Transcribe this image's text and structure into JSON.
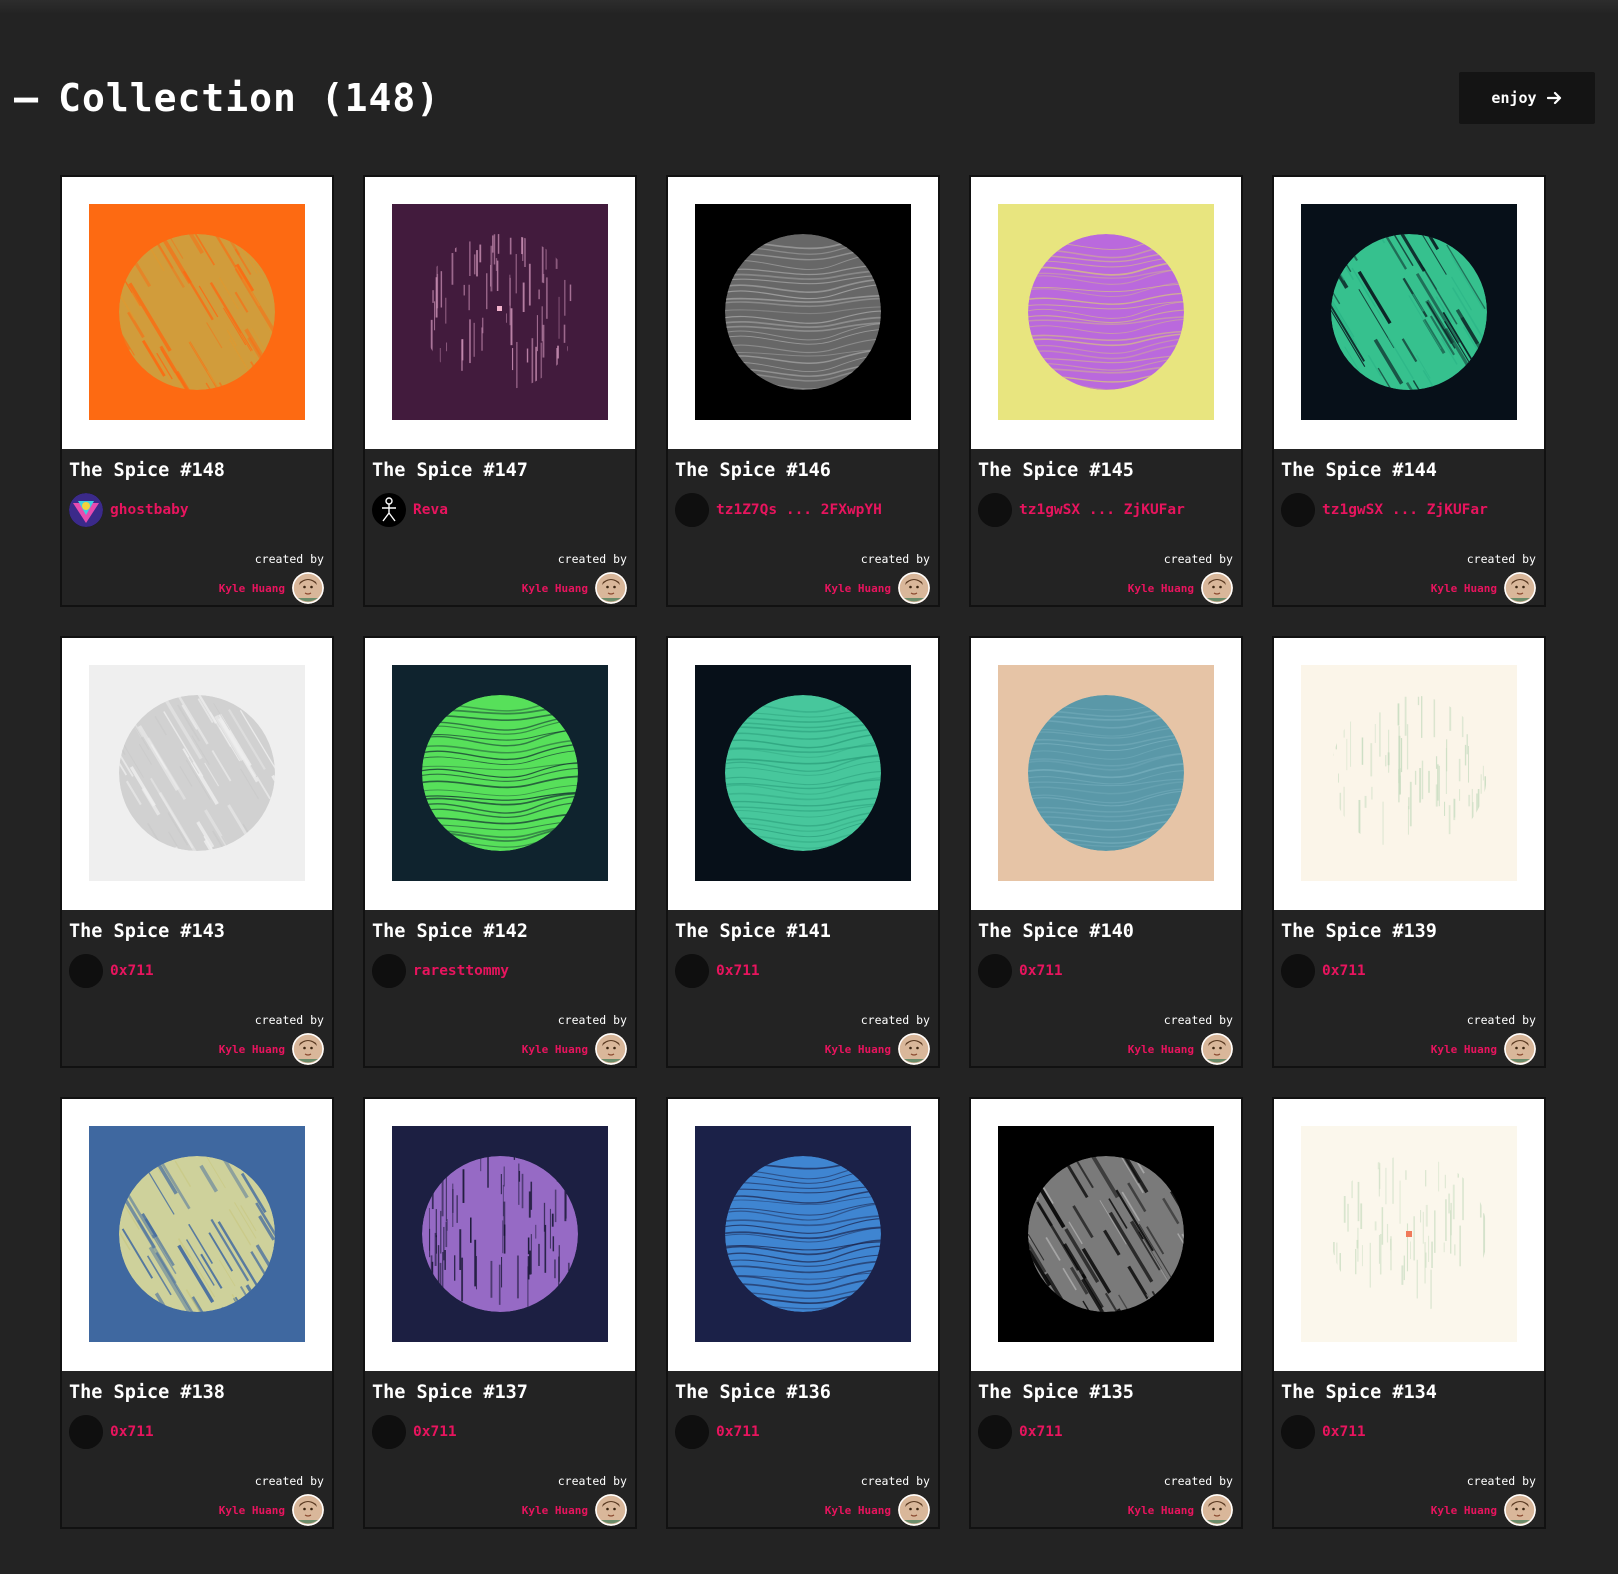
{
  "header": {
    "dash": "–",
    "title": "Collection (148)",
    "enjoy_label": "enjoy"
  },
  "cards": [
    {
      "title": "The Spice #148",
      "owner": "ghostbaby",
      "owner_avatar": "colorful-avatar",
      "created_by": "created by",
      "creator": "Kyle Huang",
      "bg": "#fd6a12",
      "fg": "#c9a443",
      "fg2": "#e09a30",
      "style": "diagonal"
    },
    {
      "title": "The Spice #147",
      "owner": "Reva",
      "owner_avatar": "stick-figure-icon",
      "created_by": "created by",
      "creator": "Kyle Huang",
      "bg": "#421b3d",
      "fg": "#c98fb4",
      "fg2": "#e6b3cc",
      "style": "sparse-vertical"
    },
    {
      "title": "The Spice #146",
      "owner": "tz1Z7Qs ... 2FXwpYH",
      "owner_avatar": "blank-avatar",
      "created_by": "created by",
      "creator": "Kyle Huang",
      "bg": "#000000",
      "fg": "#8a8a8a",
      "fg2": "#b5b5b5",
      "style": "bottom-waves"
    },
    {
      "title": "The Spice #145",
      "owner": "tz1gwSX ... ZjKUFar",
      "owner_avatar": "blank-avatar",
      "created_by": "created by",
      "creator": "Kyle Huang",
      "bg": "#e8e57f",
      "fg": "#b55be8",
      "fg2": "#d9c87a",
      "style": "waves"
    },
    {
      "title": "The Spice #144",
      "owner": "tz1gwSX ... ZjKUFar",
      "owner_avatar": "blank-avatar",
      "created_by": "created by",
      "creator": "Kyle Huang",
      "bg": "#071019",
      "fg": "#3ee0a3",
      "fg2": "#2bb385",
      "style": "diagonal"
    },
    {
      "title": "The Spice #143",
      "owner": "0x711",
      "owner_avatar": "blank-avatar",
      "created_by": "created by",
      "creator": "Kyle Huang",
      "bg": "#efefef",
      "fg": "#9a9a9a",
      "fg2": "#c8c8c8",
      "style": "diagonal-fade"
    },
    {
      "title": "The Spice #142",
      "owner": "raresttommy",
      "owner_avatar": "blank-avatar",
      "created_by": "created by",
      "creator": "Kyle Huang",
      "bg": "#0f232e",
      "fg": "#57e05a",
      "fg2": "#3fbf44",
      "style": "solid-waves"
    },
    {
      "title": "The Spice #141",
      "owner": "0x711",
      "owner_avatar": "blank-avatar",
      "created_by": "created by",
      "creator": "Kyle Huang",
      "bg": "#071019",
      "fg": "#4fdbab",
      "fg2": "#2a9e7a",
      "style": "waves"
    },
    {
      "title": "The Spice #140",
      "owner": "0x711",
      "owner_avatar": "blank-avatar",
      "created_by": "created by",
      "creator": "Kyle Huang",
      "bg": "#e6c4a6",
      "fg": "#4a93a8",
      "fg2": "#79b0bf",
      "style": "waves"
    },
    {
      "title": "The Spice #139",
      "owner": "0x711",
      "owner_avatar": "blank-avatar",
      "created_by": "created by",
      "creator": "Kyle Huang",
      "bg": "#fbf5e9",
      "fg": "#c7dcc0",
      "fg2": "#e0d6bd",
      "style": "sparse-vertical"
    },
    {
      "title": "The Spice #138",
      "owner": "0x711",
      "owner_avatar": "blank-avatar",
      "created_by": "created by",
      "creator": "Kyle Huang",
      "bg": "#3f68a0",
      "fg": "#e8e49a",
      "fg2": "#c9c77f",
      "style": "diagonal"
    },
    {
      "title": "The Spice #137",
      "owner": "0x711",
      "owner_avatar": "blank-avatar",
      "created_by": "created by",
      "creator": "Kyle Huang",
      "bg": "#1c1f42",
      "fg": "#b57de6",
      "fg2": "#d9a8f0",
      "style": "vertical-drip"
    },
    {
      "title": "The Spice #136",
      "owner": "0x711",
      "owner_avatar": "blank-avatar",
      "created_by": "created by",
      "creator": "Kyle Huang",
      "bg": "#1b2148",
      "fg": "#3f85d1",
      "fg2": "#5fa0e6",
      "style": "solid-waves"
    },
    {
      "title": "The Spice #135",
      "owner": "0x711",
      "owner_avatar": "blank-avatar",
      "created_by": "created by",
      "creator": "Kyle Huang",
      "bg": "#000000",
      "fg": "#8f8f8f",
      "fg2": "#c2c2c2",
      "style": "diagonal"
    },
    {
      "title": "The Spice #134",
      "owner": "0x711",
      "owner_avatar": "blank-avatar",
      "created_by": "created by",
      "creator": "Kyle Huang",
      "bg": "#fbf7ec",
      "fg": "#cfe0c6",
      "fg2": "#f07a5a",
      "style": "sparse-vertical"
    }
  ],
  "icons": {
    "header_dash": "dash-icon",
    "enjoy_arrow": "arrow-right-icon",
    "creator_avatar": "kyle-huang-avatar"
  }
}
